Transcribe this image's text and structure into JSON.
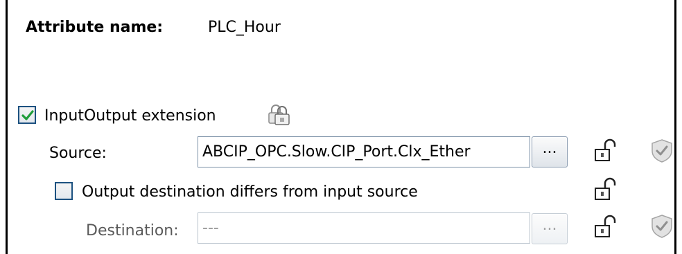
{
  "attribute": {
    "label": "Attribute name:",
    "value": "PLC_Hour"
  },
  "io_extension": {
    "checked": true,
    "label": "InputOutput extension",
    "lock_icon": "multi-lock-icon"
  },
  "source": {
    "label": "Source:",
    "value": "ABCIP_OPC.Slow.CIP_Port.Clx_Ether",
    "browse_label": "...",
    "lock_icon": "unlocked-padlock-icon",
    "validate_icon": "check-shield-icon"
  },
  "output_differs": {
    "checked": false,
    "label": "Output destination differs from input source",
    "lock_icon": "unlocked-padlock-icon"
  },
  "destination": {
    "label": "Destination:",
    "value": "---",
    "browse_label": "...",
    "lock_icon": "unlocked-padlock-icon",
    "validate_icon": "check-shield-icon"
  },
  "colors": {
    "check_green": "#1f9d3a",
    "checkbox_border": "#1c5180",
    "field_border": "#7a8fa6"
  }
}
